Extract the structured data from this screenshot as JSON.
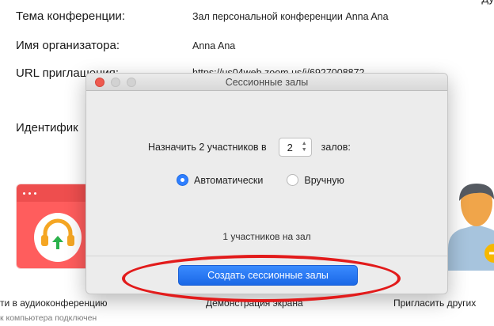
{
  "top_cut_text": "Ду",
  "meeting_info": {
    "topic_label": "Тема конференции:",
    "topic_value": "Зал персональной конференции Anna Ana",
    "host_label": "Имя организатора:",
    "host_value": "Anna Ana",
    "url_label": "URL приглашения:",
    "url_value": "https://us04web.zoom.us/j/6927008872",
    "id_label": "Идентифик"
  },
  "dialog": {
    "title": "Сессионные залы",
    "assign_prefix": "Назначить 2 участников в",
    "room_count": "2",
    "assign_suffix": "залов:",
    "options": {
      "auto_label": "Автоматически",
      "manual_label": "Вручную",
      "selected": "auto"
    },
    "per_room_text": "1 участников на зал",
    "create_button_label": "Создать сессионные залы"
  },
  "bottom_bar": {
    "audio_label": "ти в аудиоконференцию",
    "audio_sub": "к компьютера подключен",
    "share_label": "Демонстрация экрана",
    "invite_label": "Пригласить других"
  },
  "colors": {
    "accent_blue": "#2f7fff",
    "tile_red": "#ff5d5d",
    "annotation_red": "#e21b1b"
  },
  "icons": [
    "headphones-icon",
    "upload-arrow-icon",
    "person-icon",
    "plus-badge-icon"
  ]
}
